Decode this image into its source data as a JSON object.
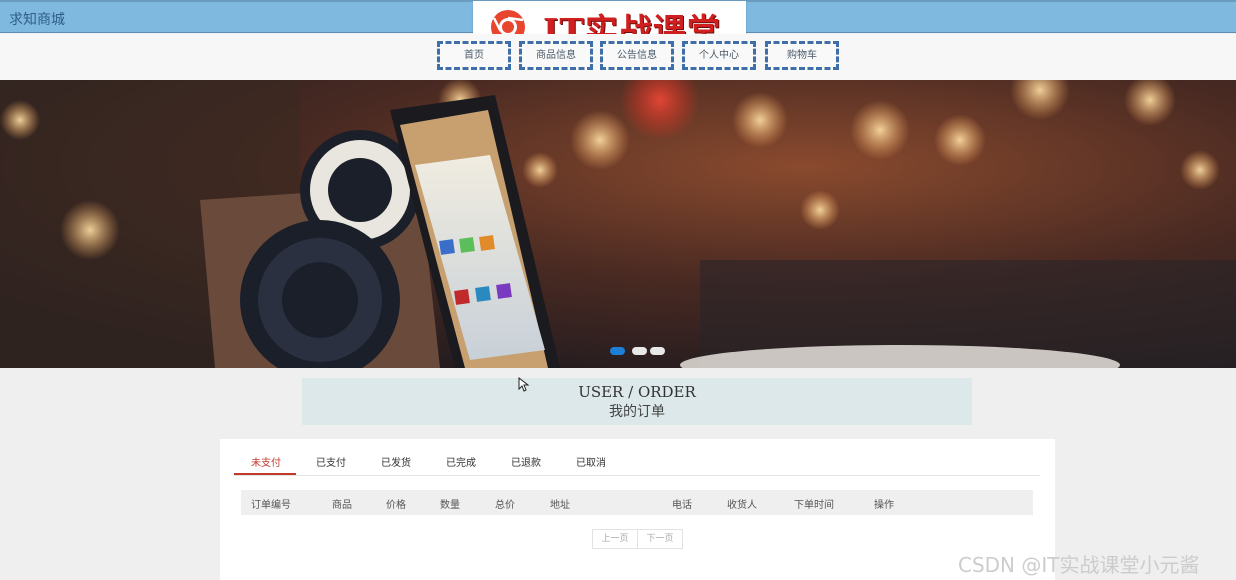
{
  "site": {
    "name": "求知商城",
    "logo_text": "IT实战课堂"
  },
  "nav": {
    "items": [
      {
        "label": "首页"
      },
      {
        "label": "商品信息"
      },
      {
        "label": "公告信息"
      },
      {
        "label": "个人中心"
      },
      {
        "label": "购物车"
      }
    ]
  },
  "banner": {
    "slide_count": 3,
    "active_slide": 1
  },
  "section": {
    "title_en": "USER / ORDER",
    "title_cn": "我的订单"
  },
  "tabs": [
    {
      "label": "未支付",
      "active": true
    },
    {
      "label": "已支付"
    },
    {
      "label": "已发货"
    },
    {
      "label": "已完成"
    },
    {
      "label": "已退款"
    },
    {
      "label": "已取消"
    }
  ],
  "table": {
    "columns": [
      "订单编号",
      "商品",
      "价格",
      "数量",
      "总价",
      "地址",
      "电话",
      "收货人",
      "下单时间",
      "操作"
    ],
    "rows": []
  },
  "pagination": {
    "prev_label": "上一页",
    "next_label": "下一页"
  },
  "watermark": "CSDN @IT实战课堂小元酱",
  "colors": {
    "topbar": "#7fb9e0",
    "accent": "#c0392b",
    "nav_border": "#3e6fa8",
    "dot_active": "#1d7fd6"
  }
}
